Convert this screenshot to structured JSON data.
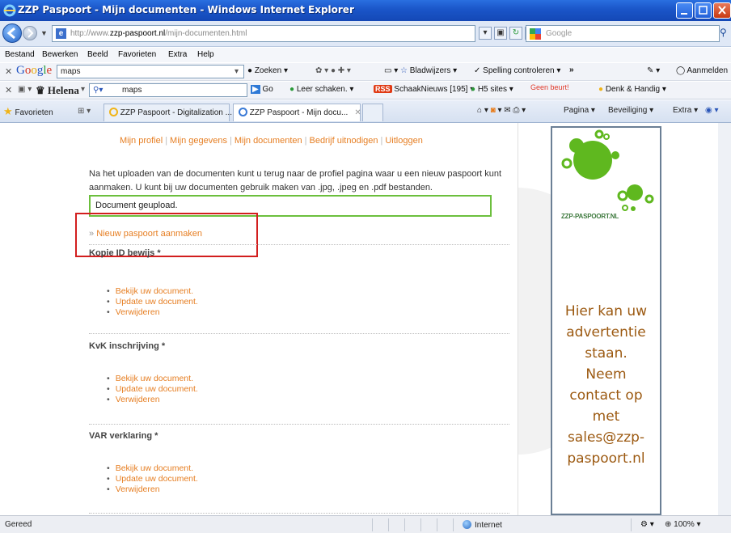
{
  "window": {
    "title": "ZZP Paspoort - Mijn documenten - Windows Internet Explorer"
  },
  "address": {
    "url_prefix": "http://www.",
    "url_domain": "zzp-paspoort.nl",
    "url_path": "/mijn-documenten.html",
    "search_placeholder": "Google"
  },
  "menu": [
    "Bestand",
    "Bewerken",
    "Beeld",
    "Favorieten",
    "Extra",
    "Help"
  ],
  "google_toolbar": {
    "logo": "Google",
    "query": "maps",
    "zoeken": "Zoeken",
    "bladwijzers": "Bladwijzers",
    "spelling": "Spelling controleren",
    "more": "»",
    "aanmelden": "Aanmelden"
  },
  "helena_toolbar": {
    "name": "Helena",
    "query": "maps",
    "go": "Go",
    "leer": "Leer schaken.",
    "rss": "RSS",
    "schaak": "SchaakNieuws [195]",
    "h5": "H5 sites",
    "geen": "Geen beurt!",
    "denk": "Denk & Handig"
  },
  "tabs": {
    "favorieten": "Favorieten",
    "items": [
      "ZZP Paspoort - Digitalization ...",
      "ZZP Paspoort - Mijn docu..."
    ],
    "pagina": "Pagina",
    "beveiliging": "Beveiliging",
    "extra": "Extra"
  },
  "page": {
    "nav": [
      "Mijn profiel",
      "Mijn gegevens",
      "Mijn documenten",
      "Bedrijf uitnodigen",
      "Uitloggen"
    ],
    "intro_line1": "Na het uploaden van de documenten kunt u terug naar de profiel pagina waar u een nieuw paspoort kunt",
    "intro_line2": "aanmaken. U kunt bij uw documenten gebruik maken van .jpg, .jpeg en .pdf bestanden.",
    "alert": "Document geupload.",
    "new_passport_prefix": "»",
    "new_passport": "Nieuw paspoort aanmaken",
    "sections": [
      {
        "title": "Kopie ID bewijs *",
        "links": [
          "Bekijk uw document.",
          "Update uw document.",
          "Verwijderen"
        ]
      },
      {
        "title": "KvK inschrijving *",
        "links": [
          "Bekijk uw document.",
          "Update uw document.",
          "Verwijderen"
        ]
      },
      {
        "title": "VAR verklaring *",
        "links": [
          "Bekijk uw document.",
          "Update uw document.",
          "Verwijderen"
        ]
      }
    ]
  },
  "ad": {
    "logo_text": "ZZP-PASPOORT.NL",
    "lines": [
      "Hier kan uw",
      "advertentie",
      "staan.",
      "Neem",
      "contact op",
      "met",
      "sales@zzp-",
      "paspoort.nl"
    ]
  },
  "status": {
    "text": "Gereed",
    "zone": "Internet",
    "zoom": "100%"
  },
  "colors": {
    "link_orange": "#e67e22",
    "alert_green": "#6cbf3d",
    "highlight_red": "#d21e1e",
    "ad_text": "#9c5a12",
    "logo_green": "#5fb81f"
  }
}
